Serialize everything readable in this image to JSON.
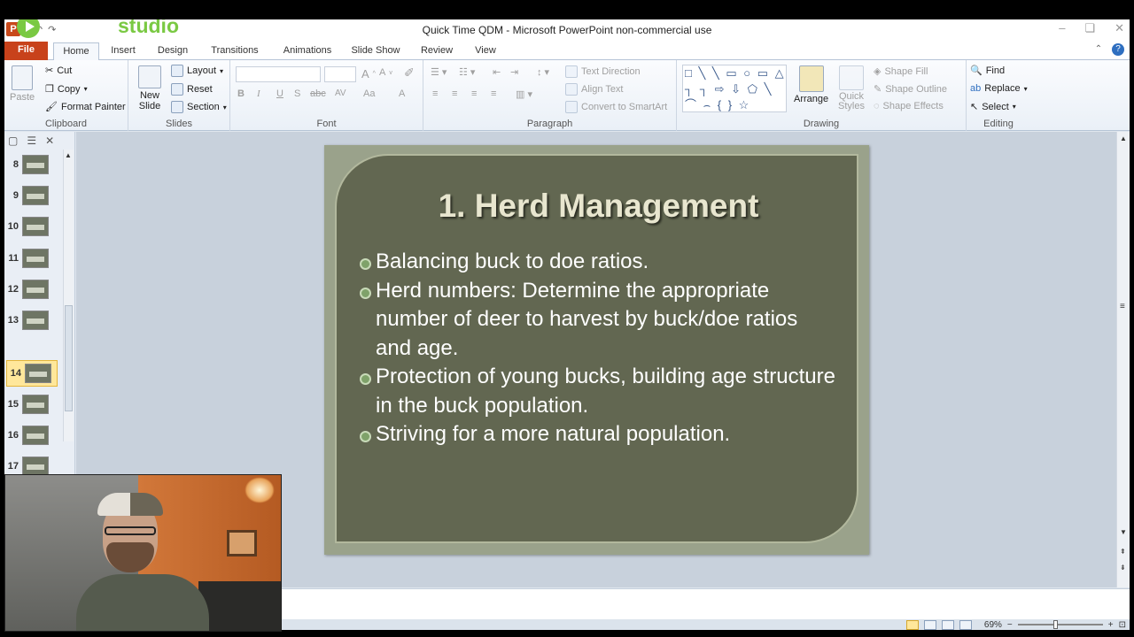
{
  "window": {
    "title": "Quick Time QDM  -  Microsoft PowerPoint non-commercial use",
    "overlay_logo_text": "studio",
    "controls": [
      "–",
      "❏",
      "✕"
    ]
  },
  "tabs": [
    "File",
    "Home",
    "Insert",
    "Design",
    "Transitions",
    "Animations",
    "Slide Show",
    "Review",
    "View"
  ],
  "ribbon": {
    "clipboard": {
      "label": "Clipboard",
      "paste": "Paste",
      "cut": "Cut",
      "copy": "Copy",
      "format_painter": "Format Painter"
    },
    "slides": {
      "label": "Slides",
      "new_slide": "New Slide",
      "layout": "Layout",
      "reset": "Reset",
      "section": "Section"
    },
    "font": {
      "label": "Font",
      "buttons": [
        "B",
        "I",
        "U",
        "S",
        "abc",
        "AV",
        "Aa",
        "A"
      ]
    },
    "paragraph": {
      "label": "Paragraph",
      "text_direction": "Text Direction",
      "align_text": "Align Text",
      "convert_smartart": "Convert to SmartArt"
    },
    "drawing": {
      "label": "Drawing",
      "shapes_glyphs": "□ ╲ ╲ ▭ ○ ▭ △ ┐ ┐ ⇨ ⇩ ⬠ ╲ ⌒ ⌢ { } ☆",
      "arrange": "Arrange",
      "quick_styles": "Quick Styles",
      "shape_fill": "Shape Fill",
      "shape_outline": "Shape Outline",
      "shape_effects": "Shape Effects"
    },
    "editing": {
      "label": "Editing",
      "find": "Find",
      "replace": "Replace",
      "select": "Select"
    }
  },
  "slide_panel": {
    "thumbnails": [
      {
        "num": "8"
      },
      {
        "num": "9"
      },
      {
        "num": "10"
      },
      {
        "num": "11"
      },
      {
        "num": "12"
      },
      {
        "num": "13"
      },
      {
        "num": "14"
      },
      {
        "num": "15"
      },
      {
        "num": "16"
      },
      {
        "num": "17"
      }
    ],
    "selected": "14"
  },
  "slide": {
    "title": "1. Herd Management",
    "bullets": [
      "Balancing buck to doe ratios.",
      "Herd numbers: Determine the appropriate number of deer to harvest by buck/doe ratios and age.",
      "Protection of young bucks, building age structure in the buck population.",
      "Striving for a more natural population."
    ],
    "colors": {
      "outer": "#9aa28b",
      "inner": "#626751",
      "title": "#e8e6cf",
      "bullet": "#7fa26a"
    }
  },
  "status": {
    "zoom": "69%",
    "minus": "−",
    "plus": "+"
  },
  "icons": [
    "powerpoint-logo-icon",
    "play-logo-icon",
    "help-icon",
    "scissors-icon",
    "copy-icon",
    "paintbrush-icon",
    "find-icon",
    "replace-icon",
    "select-icon"
  ]
}
